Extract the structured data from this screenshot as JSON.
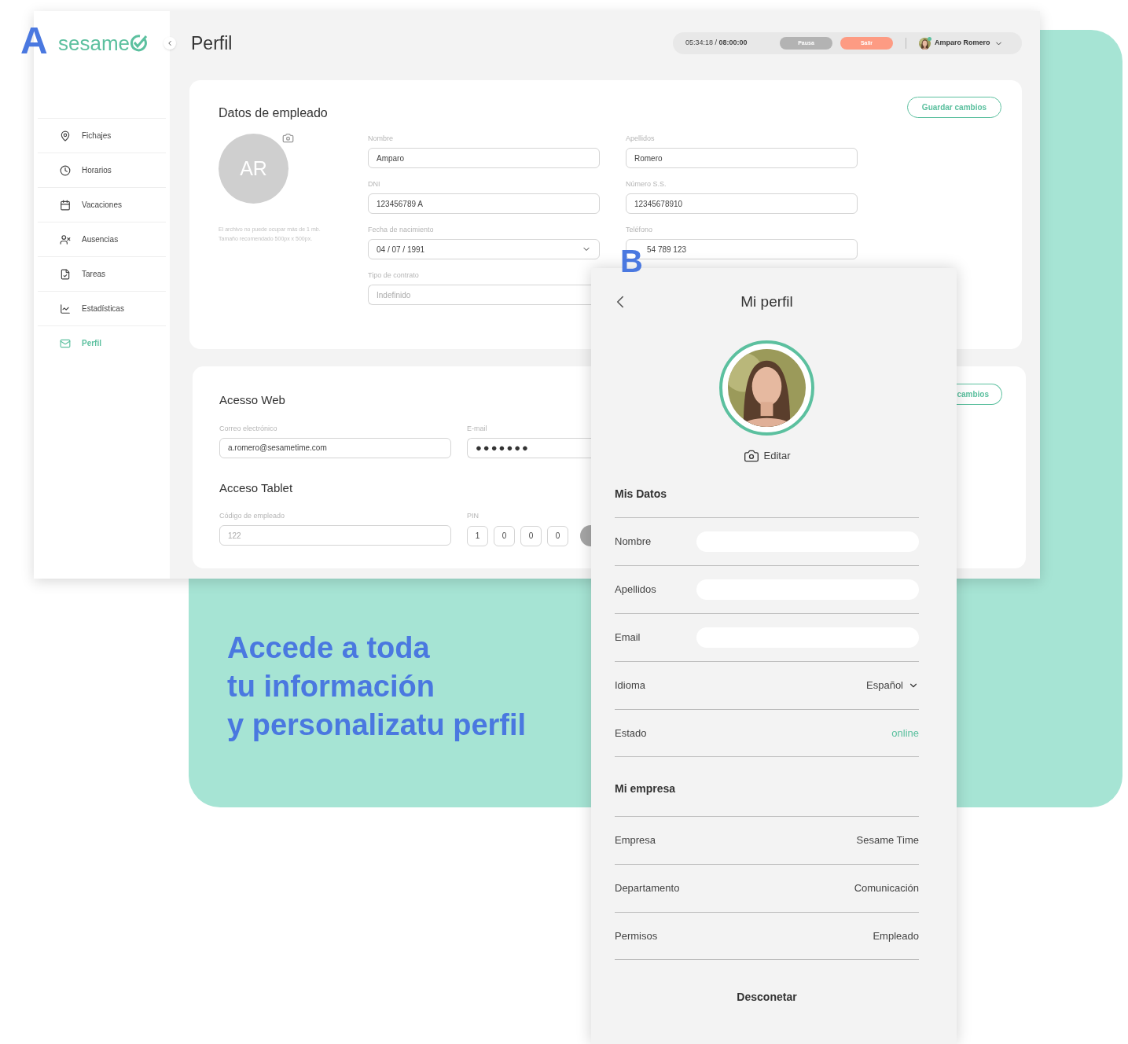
{
  "markers": [
    {
      "text": "A"
    },
    {
      "text": "B"
    }
  ],
  "headline": [
    "Accede a toda",
    "tu información",
    "y personalizatu perfil"
  ],
  "desktop": {
    "logo": "sesame",
    "page_title": "Perfil",
    "sidebar": {
      "items": [
        {
          "label": "Fichajes",
          "selected": false
        },
        {
          "label": "Horarios",
          "selected": false
        },
        {
          "label": "Vacaciones",
          "selected": false
        },
        {
          "label": "Ausencias",
          "selected": false
        },
        {
          "label": "Tareas",
          "selected": false
        },
        {
          "label": "Estadísticas",
          "selected": false
        },
        {
          "label": "Perfil",
          "selected": true
        }
      ]
    },
    "top_bar": {
      "timer": "05:34:18 / **08:00:00**",
      "buttons": [
        {
          "label": "Pausa",
          "kind": "pause"
        },
        {
          "label": "Salir",
          "kind": "exit"
        }
      ],
      "user": "Amparo Romero"
    },
    "employee_card": {
      "title": "Datos de empleado",
      "save_button": "Guardar cambios",
      "avatar_initials": "AR",
      "hint": "El archivo no puede ocupar más de 1 mb. Tamaño recomendado 500px x 500px.",
      "fields": [
        {
          "label": "Nombre",
          "value": "Amparo",
          "kind": "text"
        },
        {
          "label": "Apellidos",
          "value": "Romero",
          "kind": "text"
        },
        {
          "label": "DNI",
          "value": "123456789 A",
          "kind": "text"
        },
        {
          "label": "Número S.S.",
          "value": "12345678910",
          "kind": "text"
        },
        {
          "label": "Fecha de nacimiento",
          "value": "04 / 07 / 1991",
          "kind": "select"
        },
        {
          "label": "Teléfono",
          "value": "54 789 123",
          "kind": "text"
        },
        {
          "label": "Tipo de contrato",
          "placeholder": "Indefinido",
          "kind": "text"
        }
      ]
    },
    "access_card": {
      "save_button": "cambios",
      "web": {
        "title": "Acesso Web",
        "fields": [
          {
            "label": "Correo electrónico",
            "value": "a.romero@sesametime.com",
            "kind": "text"
          },
          {
            "label": "E-mail",
            "value": "●●●●●●●",
            "kind": "password"
          }
        ]
      },
      "tablet": {
        "title": "Acceso Tablet",
        "code": {
          "label": "Código de empleado",
          "placeholder": "122"
        },
        "pin": {
          "label": "PIN",
          "digits": [
            "1",
            "0",
            "0",
            "0"
          ]
        }
      }
    }
  },
  "mobile": {
    "title": "Mi perfil",
    "edit": "Editar",
    "sections": [
      {
        "title": "Mis Datos",
        "rows": [
          {
            "label": "Nombre",
            "kind": "input"
          },
          {
            "label": "Apellidos",
            "kind": "input"
          },
          {
            "label": "Email",
            "kind": "input"
          },
          {
            "label": "Idioma",
            "value": "Español",
            "kind": "select"
          },
          {
            "label": "Estado",
            "value": "online",
            "kind": "status"
          }
        ]
      },
      {
        "title": "Mi empresa",
        "rows": [
          {
            "label": "Empresa",
            "value": "Sesame Time",
            "kind": "text"
          },
          {
            "label": "Departamento",
            "value": "Comunicación",
            "kind": "text"
          },
          {
            "label": "Permisos",
            "value": "Empleado",
            "kind": "text"
          }
        ]
      }
    ],
    "logout": "Desconetar"
  }
}
